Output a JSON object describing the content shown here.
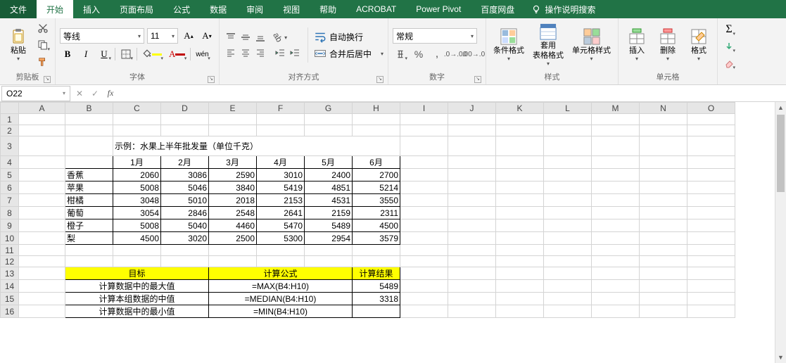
{
  "tabs": {
    "file": "文件",
    "home": "开始",
    "insert": "插入",
    "layout": "页面布局",
    "formulas": "公式",
    "data": "数据",
    "review": "审阅",
    "view": "视图",
    "help": "帮助",
    "acrobat": "ACROBAT",
    "pivot": "Power Pivot",
    "baidu": "百度网盘",
    "tell_me": "操作说明搜索"
  },
  "ribbon": {
    "clipboard": {
      "paste": "粘贴",
      "label": "剪贴板"
    },
    "font": {
      "name": "等线",
      "size": "11",
      "label": "字体",
      "ruby": "wén"
    },
    "alignment": {
      "wrap": "自动换行",
      "merge": "合并后居中",
      "label": "对齐方式"
    },
    "number": {
      "format": "常规",
      "label": "数字"
    },
    "styles": {
      "cond": "条件格式",
      "table": "套用\n表格格式",
      "cell": "单元格样式",
      "label": "样式"
    },
    "cells": {
      "insert": "插入",
      "delete": "删除",
      "format": "格式",
      "label": "单元格"
    }
  },
  "formula_bar": {
    "name_box": "O22",
    "formula": ""
  },
  "columns": [
    "A",
    "B",
    "C",
    "D",
    "E",
    "F",
    "G",
    "H",
    "I",
    "J",
    "K",
    "L",
    "M",
    "N",
    "O"
  ],
  "rows": [
    "1",
    "2",
    "3",
    "4",
    "5",
    "6",
    "7",
    "8",
    "9",
    "10",
    "11",
    "12",
    "13",
    "14",
    "15",
    "16"
  ],
  "sheet": {
    "title": "示例：水果上半年批发量（单位千克）",
    "months": [
      "1月",
      "2月",
      "3月",
      "4月",
      "5月",
      "6月"
    ],
    "data": [
      {
        "name": "香蕉",
        "v": [
          2060,
          3086,
          2590,
          3010,
          2400,
          2700
        ]
      },
      {
        "name": "苹果",
        "v": [
          5008,
          5046,
          3840,
          5419,
          4851,
          5214
        ]
      },
      {
        "name": "柑橘",
        "v": [
          3048,
          5010,
          2018,
          2153,
          4531,
          3550
        ]
      },
      {
        "name": "葡萄",
        "v": [
          3054,
          2846,
          2548,
          2641,
          2159,
          2311
        ]
      },
      {
        "name": "橙子",
        "v": [
          5008,
          5040,
          4460,
          5470,
          5489,
          4500
        ]
      },
      {
        "name": "梨",
        "v": [
          4500,
          3020,
          2500,
          5300,
          2954,
          3579
        ]
      }
    ],
    "hdr_goal": "目标",
    "hdr_formula": "计算公式",
    "hdr_result": "计算结果",
    "goals": [
      {
        "g": "计算数据中的最大值",
        "f": "=MAX(B4:H10)",
        "r": "5489"
      },
      {
        "g": "计算本组数据的中值",
        "f": "=MEDIAN(B4:H10)",
        "r": "3318"
      },
      {
        "g": "计算数据中的最小值",
        "f": "=MIN(B4:H10)",
        "r": ""
      }
    ]
  }
}
